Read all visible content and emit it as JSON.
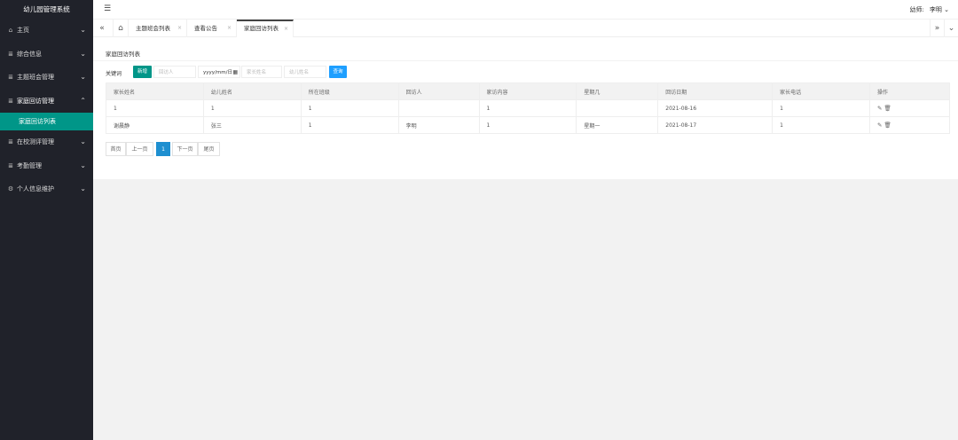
{
  "app": {
    "title": "幼儿园管理系统"
  },
  "sidebar": {
    "items": [
      {
        "label": "主页",
        "icon": "home-icon"
      },
      {
        "label": "综合信息",
        "icon": "list-icon"
      },
      {
        "label": "主题班会管理",
        "icon": "list-icon"
      },
      {
        "label": "家庭回访管理",
        "icon": "list-icon"
      },
      {
        "label": "在校测评管理",
        "icon": "list-icon"
      },
      {
        "label": "考勤管理",
        "icon": "list-icon"
      },
      {
        "label": "个人信息维护",
        "icon": "gear-icon"
      }
    ],
    "active_sub": "家庭回访列表"
  },
  "header": {
    "user_role": "幼师:",
    "user_name": "李明"
  },
  "tabs": [
    {
      "label": "主题班会列表"
    },
    {
      "label": "查看公告"
    },
    {
      "label": "家庭回访列表"
    }
  ],
  "main": {
    "panel_title": "家庭回访列表",
    "search": {
      "keyword_label": "关键词",
      "add_label": "新增",
      "visitor_placeholder": "回访人",
      "date_value": "yyyy/mm/日",
      "parent_placeholder": "家长姓名",
      "child_placeholder": "幼儿姓名",
      "search_label": "查询"
    },
    "table": {
      "headers": [
        "家长姓名",
        "幼儿姓名",
        "所在班级",
        "回访人",
        "家访内容",
        "星期几",
        "回访日期",
        "家长电话",
        "操作"
      ],
      "rows": [
        [
          "1",
          "1",
          "1",
          "",
          "1",
          "",
          "2021-08-16",
          "1"
        ],
        [
          "谢晨静",
          "张三",
          "1",
          "李明",
          "1",
          "星期一",
          "2021-08-17",
          "1"
        ]
      ]
    },
    "pager": {
      "first": "首页",
      "prev": "上一页",
      "current": "1",
      "next": "下一页",
      "last": "尾页"
    }
  },
  "colors": {
    "sidebar_bg": "#20222a",
    "accent": "#009688",
    "search_btn": "#1e9fff",
    "page_active": "#1e8fd0"
  }
}
